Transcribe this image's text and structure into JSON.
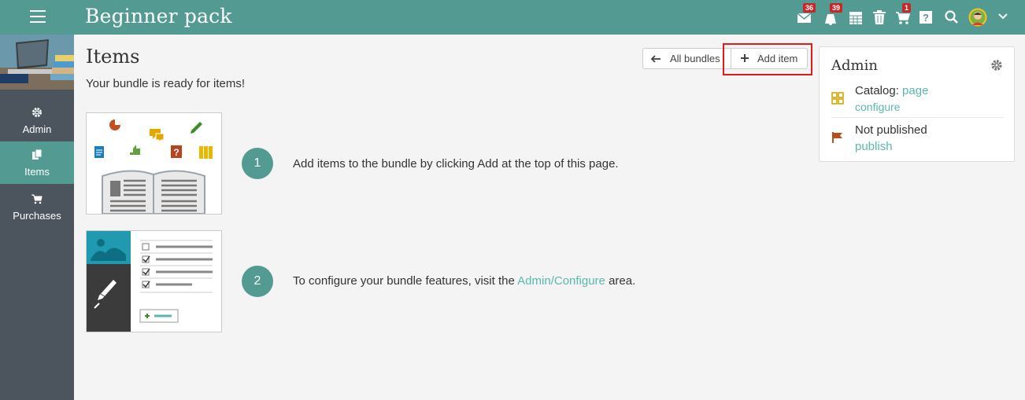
{
  "header": {
    "title": "Beginner pack",
    "badges": {
      "messages": "36",
      "notifications": "39",
      "cart": "1"
    },
    "icons": [
      "hamburger-menu-icon",
      "envelope-icon",
      "bell-icon",
      "calendar-icon",
      "trash-icon",
      "cart-icon",
      "help-icon",
      "search-icon",
      "avatar",
      "chevron-down-icon"
    ]
  },
  "sidebar": {
    "items": [
      {
        "label": "Admin",
        "icon": "gear-icon"
      },
      {
        "label": "Items",
        "icon": "copy-icon",
        "active": true
      },
      {
        "label": "Purchases",
        "icon": "cart-icon"
      }
    ]
  },
  "main": {
    "title": "Items",
    "subtitle": "Your bundle is ready for items!",
    "buttons": {
      "all_bundles": "All bundles",
      "add_item": "Add item"
    },
    "steps": [
      {
        "number": "1",
        "text": "Add items to the bundle by clicking Add at the top of this page."
      },
      {
        "number": "2",
        "text_before": "To configure your bundle features, visit the ",
        "link": "Admin/Configure",
        "text_after": " area."
      }
    ]
  },
  "admin_panel": {
    "title": "Admin",
    "catalog_label": "Catalog: ",
    "catalog_link": "page",
    "configure_link": "configure",
    "status": "Not published",
    "publish_link": "publish"
  },
  "colors": {
    "brand": "#539b92",
    "link": "#5ab8ad",
    "sidebar": "#4c555e",
    "badge": "#c62828",
    "highlight": "#e31a1a"
  }
}
